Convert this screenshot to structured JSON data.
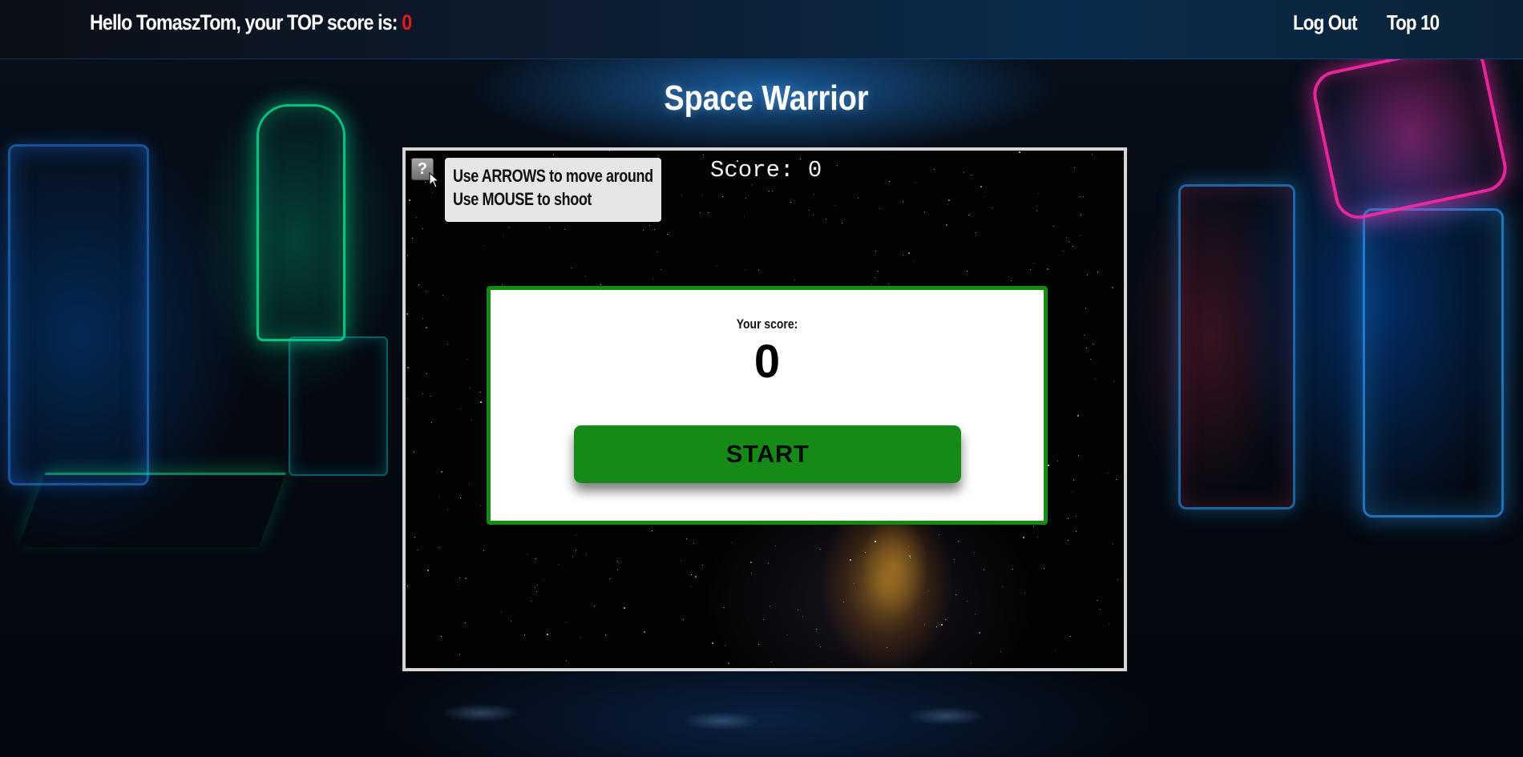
{
  "header": {
    "greeting_prefix": "Hello TomaszTom, your TOP score is: ",
    "top_score": "0",
    "nav": {
      "logout_label": "Log Out",
      "top10_label": "Top 10"
    }
  },
  "game": {
    "title": "Space Warrior",
    "score_label": "Score: ",
    "score_value": "0",
    "help": {
      "icon": "question-mark-icon",
      "icon_glyph": "?",
      "lines": [
        "Use ARROWS to move around",
        "Use MOUSE to shoot"
      ]
    },
    "dialog": {
      "your_score_label": "Your score:",
      "your_score_value": "0",
      "start_label": "START"
    }
  },
  "colors": {
    "top_score": "#e8191d",
    "dialog_border": "#138c13",
    "start_button": "#168a16",
    "frame_border": "#d6d6d6",
    "tooltip_bg": "#e6e6e6"
  }
}
